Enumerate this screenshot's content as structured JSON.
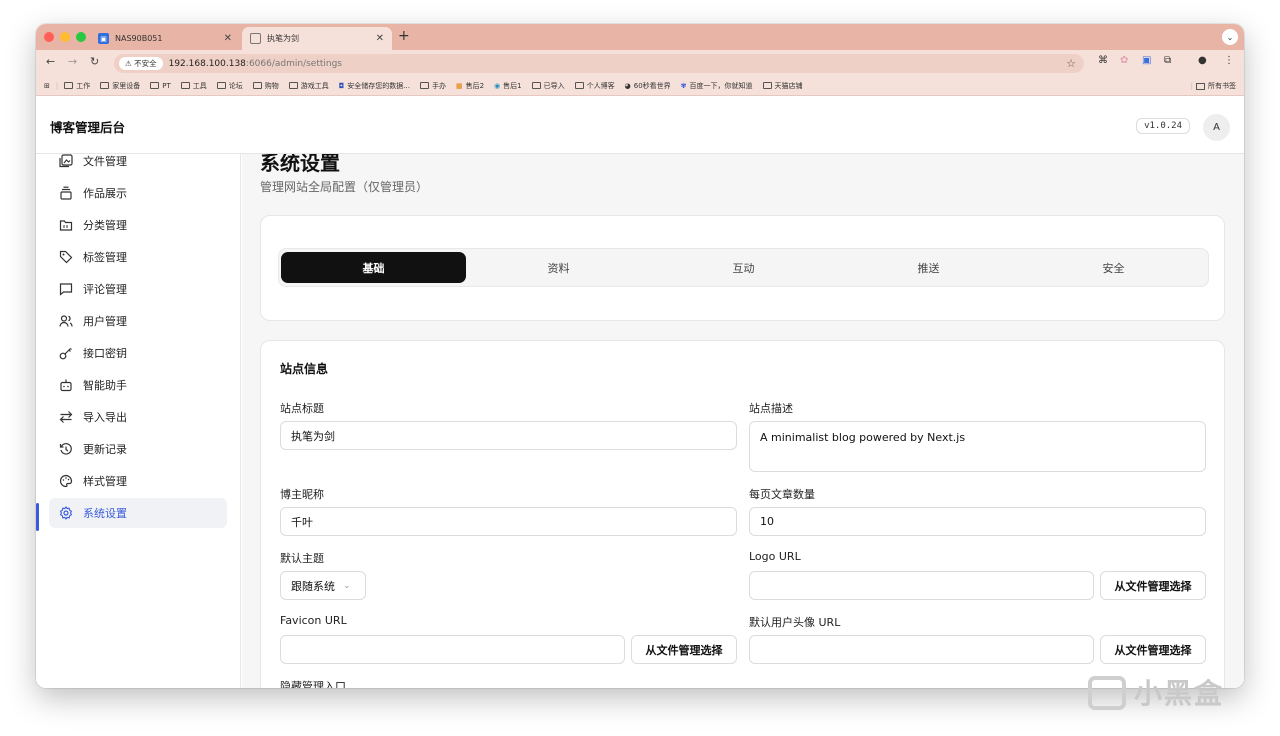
{
  "browser": {
    "tabs": [
      {
        "title": "NAS90B051"
      },
      {
        "title": "执笔为剑"
      }
    ],
    "address": {
      "insecure_label": "不安全",
      "host": "192.168.100.138",
      "path": ":6066/admin/settings"
    },
    "bookmarks": [
      "工作",
      "家里设备",
      "PT",
      "工具",
      "论坛",
      "购物",
      "游戏工具",
      "安全储存您的数据...",
      "手办",
      "售后2",
      "售后1",
      "已导入",
      "个人博客",
      "60秒看世界",
      "百度一下，你就知道",
      "天猫店铺"
    ],
    "all_bookmarks": "所有书签"
  },
  "app": {
    "brand": "博客管理后台",
    "version": "v1.0.24",
    "avatar": "A"
  },
  "sidebar": {
    "items": [
      {
        "label": "文件管理",
        "icon": "image-file-icon"
      },
      {
        "label": "作品展示",
        "icon": "stack-icon"
      },
      {
        "label": "分类管理",
        "icon": "folder-icon"
      },
      {
        "label": "标签管理",
        "icon": "tag-icon"
      },
      {
        "label": "评论管理",
        "icon": "comment-icon"
      },
      {
        "label": "用户管理",
        "icon": "users-icon"
      },
      {
        "label": "接口密钥",
        "icon": "key-icon"
      },
      {
        "label": "智能助手",
        "icon": "bot-icon"
      },
      {
        "label": "导入导出",
        "icon": "arrows-icon"
      },
      {
        "label": "更新记录",
        "icon": "history-icon"
      },
      {
        "label": "样式管理",
        "icon": "palette-icon"
      },
      {
        "label": "系统设置",
        "icon": "gear-icon"
      }
    ],
    "active": "系统设置"
  },
  "page": {
    "title": "系统设置",
    "subtitle": "管理网站全局配置（仅管理员）"
  },
  "settings_tabs": [
    "基础",
    "资料",
    "互动",
    "推送",
    "安全"
  ],
  "form": {
    "section_title": "站点信息",
    "site_title_label": "站点标题",
    "site_title_value": "执笔为剑",
    "site_desc_label": "站点描述",
    "site_desc_value": "A minimalist blog powered by Next.js",
    "nickname_label": "博主昵称",
    "nickname_value": "千叶",
    "per_page_label": "每页文章数量",
    "per_page_value": "10",
    "theme_label": "默认主题",
    "theme_value": "跟随系统",
    "logo_label": "Logo URL",
    "logo_value": "",
    "favicon_label": "Favicon URL",
    "favicon_value": "",
    "avatar_label": "默认用户头像 URL",
    "avatar_value": "",
    "pick_button": "从文件管理选择",
    "hidden_entry_label": "隐藏管理入口"
  },
  "watermark": "小黑盒",
  "colors": {
    "accent": "#3b5bdb",
    "tab_active_bg": "#111111",
    "browser_frame": "#e8b4a5"
  }
}
